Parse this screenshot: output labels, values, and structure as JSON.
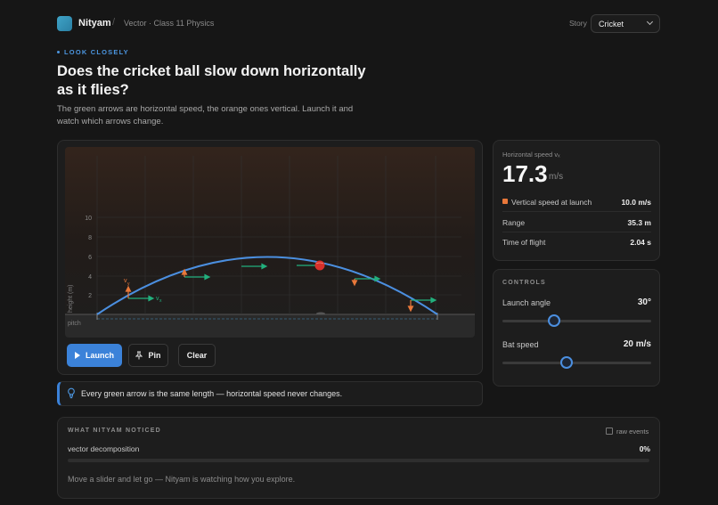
{
  "app": {
    "brand": "Nityam",
    "breadcrumb": "Vector · Class 11 Physics"
  },
  "story": {
    "label": "Story",
    "selected": "Cricket"
  },
  "lesson": {
    "eyebrow": "LOOK CLOSELY",
    "title": "Does the cricket ball slow down horizontally as it flies?",
    "subtitle": "The green arrows are horizontal speed, the orange ones vertical. Launch it and watch which arrows change."
  },
  "sim": {
    "y_axis_label": "height (m)",
    "y_ticks": [
      "10",
      "8",
      "6",
      "4",
      "2"
    ],
    "ground_label": "pitch",
    "vy_label": "v",
    "vy_sub": "y",
    "vx_label": "v",
    "vx_sub": "x"
  },
  "buttons": {
    "launch": "Launch",
    "pin": "Pin",
    "clear": "Clear"
  },
  "hint": "Every green arrow is the same length — horizontal speed never changes.",
  "stats": {
    "horizontal_label": "Horizontal speed vₓ",
    "horizontal_value": "17.3",
    "horizontal_unit": "m/s",
    "rows": [
      {
        "label": "Vertical speed at launch",
        "value": "10.0 m/s"
      },
      {
        "label": "Range",
        "value": "35.3 m"
      },
      {
        "label": "Time of flight",
        "value": "2.04 s"
      }
    ]
  },
  "controls": {
    "heading": "CONTROLS",
    "angle_label": "Launch angle",
    "angle_value": "30°",
    "angle_fraction": 0.35,
    "speed_label": "Bat speed",
    "speed_value": "20 m/s",
    "speed_fraction": 0.43
  },
  "noticed": {
    "heading": "WHAT NITYAM NOTICED",
    "raw_events_label": "raw events",
    "metric_label": "vector decomposition",
    "metric_value": "0%",
    "metric_fraction": 0,
    "footnote": "Move a slider and let go — Nityam is watching how you explore."
  },
  "colors": {
    "accent": "#3b82d9",
    "horizontal_arrow": "#22b07d",
    "vertical_arrow": "#e9783a",
    "ball": "#d8302b"
  }
}
